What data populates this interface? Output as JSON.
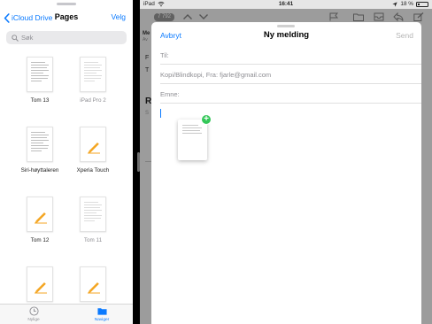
{
  "files_pane": {
    "back_label": "iCloud Drive",
    "title": "Pages",
    "select_label": "Velg",
    "search_placeholder": "Søk",
    "files": [
      {
        "name": "Tom 13",
        "kind": "doc"
      },
      {
        "name": "iPad Pro 2",
        "kind": "doc-faint"
      },
      {
        "name": "Siri-høyttaleren",
        "kind": "doc"
      },
      {
        "name": "Xperia Touch",
        "kind": "pages"
      },
      {
        "name": "Tom 12",
        "kind": "pages"
      },
      {
        "name": "Tom 11",
        "kind": "doc-faint"
      },
      {
        "name": "",
        "kind": "pages"
      },
      {
        "name": "",
        "kind": "pages"
      }
    ],
    "tabs": [
      {
        "label": "Nylige",
        "icon": "clock-icon",
        "active": false
      },
      {
        "label": "Naviger",
        "icon": "folder-icon",
        "active": true
      }
    ],
    "accent_color": "#0a7aff"
  },
  "status_bar": {
    "device": "iPad",
    "time": "16:41",
    "battery": "18 %"
  },
  "mail": {
    "unread_badge": "7 792",
    "background_text": [
      "Me",
      "Av",
      "F",
      "T",
      "R",
      "S"
    ],
    "compose": {
      "cancel_label": "Avbryt",
      "title": "Ny melding",
      "send_label": "Send",
      "to_label": "Til:",
      "cc_label": "Kopi/Blindkopi, Fra: fjarle@gmail.com",
      "subject_label": "Emne:"
    },
    "drag_badge": "+"
  }
}
